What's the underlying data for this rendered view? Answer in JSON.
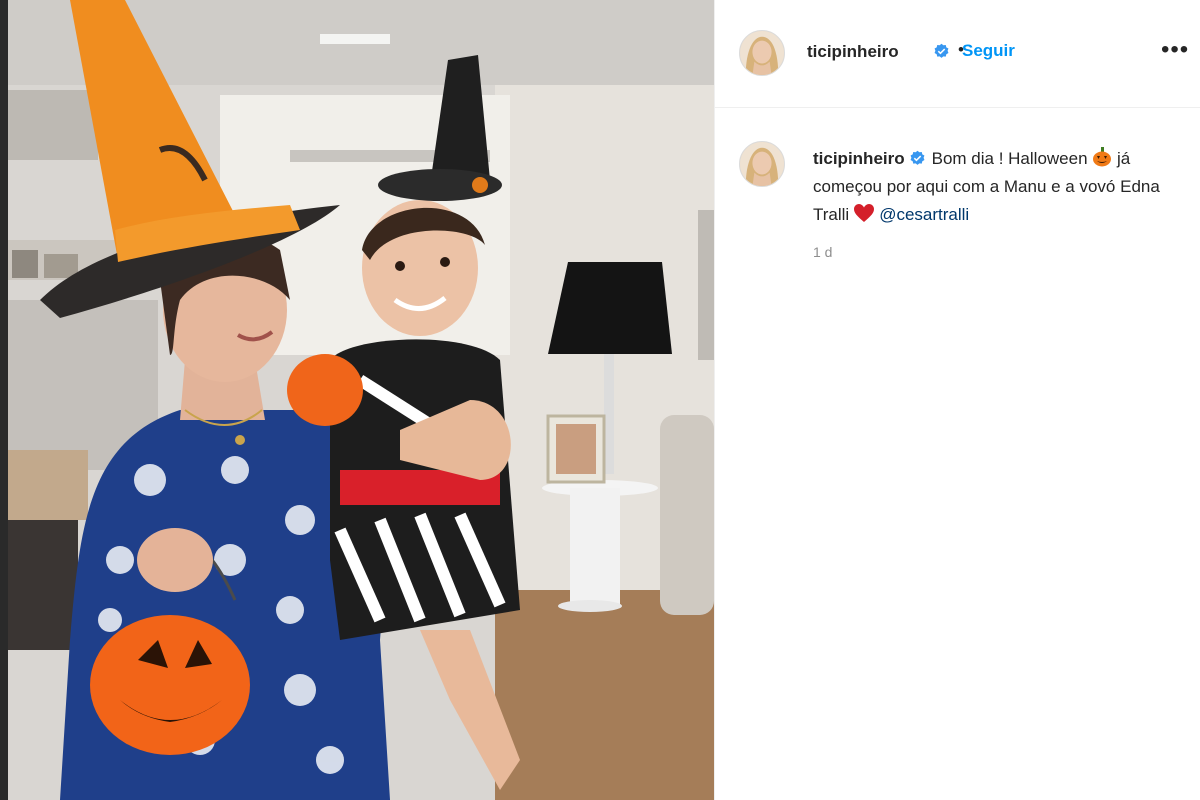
{
  "post": {
    "username": "ticipinheiro",
    "follow_label": "Seguir",
    "more_label": "•••",
    "separator": "•"
  },
  "caption": {
    "username": "ticipinheiro",
    "text_part1": "Bom dia ! Halloween",
    "text_part2": "já começou por aqui com a Manu e a vovó Edna Tralli",
    "mention": "@cesartralli",
    "timestamp": "1 d"
  },
  "icons": {
    "verified": "verified-badge-icon",
    "pumpkin": "jack-o-lantern-emoji-icon",
    "heart": "red-heart-emoji-icon",
    "more": "more-options-icon"
  },
  "colors": {
    "follow_blue": "#0095f6",
    "mention_blue": "#00376b",
    "verified_blue": "#3897f0",
    "text": "#262626",
    "muted": "#8e8e8e"
  }
}
